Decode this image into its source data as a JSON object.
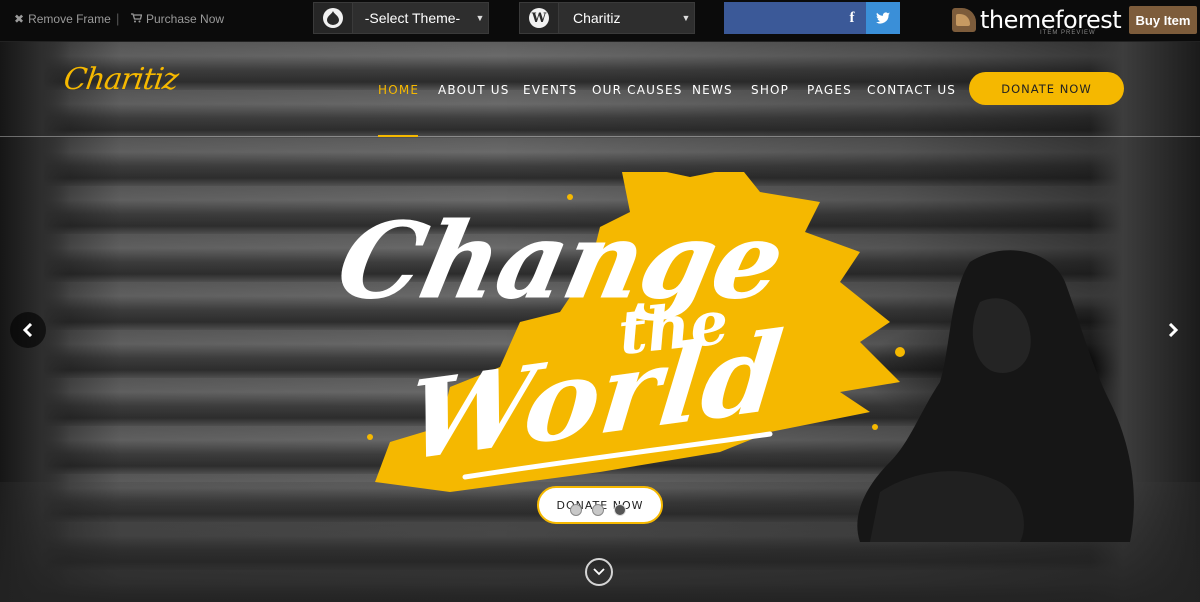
{
  "frame_bar": {
    "remove_frame": "Remove Frame",
    "purchase_now": "Purchase Now",
    "theme_select": {
      "value": "-Select Theme-"
    },
    "site_select": {
      "value": "Charitiz"
    },
    "brand": "themeforest",
    "brand_sub": "ITEM PREVIEW",
    "buy_item": "Buy Item"
  },
  "site": {
    "logo": "Charitiz",
    "nav": [
      "HOME",
      "ABOUT US",
      "EVENTS",
      "OUR CAUSES",
      "NEWS",
      "SHOP",
      "PAGES",
      "CONTACT US"
    ],
    "active_nav": "HOME",
    "donate_button": "DONATE NOW"
  },
  "slider": {
    "headline": [
      "Change",
      "the",
      "World"
    ],
    "button": "DONATE NOW",
    "slides": 3,
    "active_slide": 3
  },
  "colors": {
    "accent": "#f5b800",
    "frame_bar": "#0b0b0b",
    "facebook": "#3b5998",
    "twitter": "#3a8fd8",
    "buy": "#7d5c3b"
  },
  "icons": {
    "remove_frame": "close-icon",
    "purchase": "cart-icon",
    "theme_select": "drupal-icon",
    "site_select": "wordpress-icon",
    "social": [
      "facebook-icon",
      "twitter-icon"
    ],
    "slider_prev": "chevron-left-icon",
    "slider_next": "chevron-right-icon",
    "scroll": "chevron-down-icon"
  }
}
